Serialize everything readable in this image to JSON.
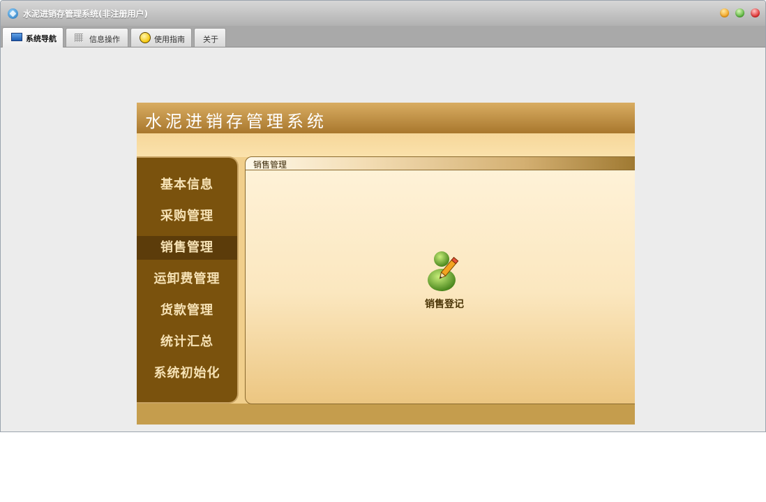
{
  "window": {
    "title": "水泥进销存管理系统(非注册用户)"
  },
  "tabs": [
    {
      "label": "系统导航",
      "icon": "monitor-icon",
      "active": true
    },
    {
      "label": "信息操作",
      "icon": "grid-icon",
      "active": false
    },
    {
      "label": "使用指南",
      "icon": "help-circle-icon",
      "active": false
    },
    {
      "label": "关于",
      "icon": "",
      "active": false
    }
  ],
  "app": {
    "title": "水泥进销存管理系统"
  },
  "sidebar": {
    "items": [
      {
        "label": "基本信息"
      },
      {
        "label": "采购管理"
      },
      {
        "label": "销售管理",
        "active": true
      },
      {
        "label": "运卸费管理"
      },
      {
        "label": "货款管理"
      },
      {
        "label": "统计汇总"
      },
      {
        "label": "系统初始化"
      }
    ]
  },
  "panel": {
    "title": "销售管理",
    "features": [
      {
        "label": "销售登记",
        "icon": "user-edit-icon"
      }
    ]
  },
  "colors": {
    "sidebar_bg": "#7a520d",
    "sidebar_active": "#5c3c0a",
    "header": "#b8893d",
    "panel_bg": "#fbe7bf"
  }
}
